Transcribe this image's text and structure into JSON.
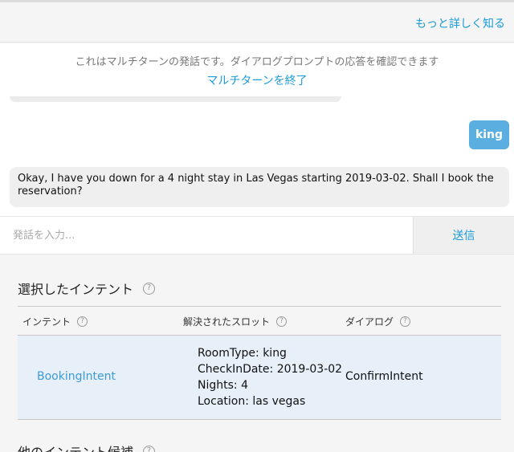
{
  "header": {
    "learn_more": "もっと詳しく知る"
  },
  "chat": {
    "notice": "これはマルチターンの発話です。ダイアログプロンプトの応答を確認できます",
    "end_multiturn": "マルチターンを終了",
    "user_message": "king",
    "bot_message": "Okay, I have you down for a 4 night stay in Las Vegas starting 2019-03-02. Shall I book the reservation?"
  },
  "input": {
    "placeholder": "発話を入力...",
    "value": "",
    "send_label": "送信"
  },
  "selected_intent": {
    "title": "選択したインテント",
    "help": "?",
    "columns": [
      {
        "label": "インテント",
        "help": "?"
      },
      {
        "label": "解決されたスロット",
        "help": "?"
      },
      {
        "label": "ダイアログ",
        "help": "?"
      }
    ],
    "row": {
      "intent": "BookingIntent",
      "slots": [
        "RoomType: king",
        "CheckInDate: 2019-03-02",
        "Nights: 4",
        "Location: las vegas"
      ],
      "dialog": "ConfirmIntent"
    }
  },
  "other_intents": {
    "title": "他のインテント候補",
    "help": "?"
  }
}
